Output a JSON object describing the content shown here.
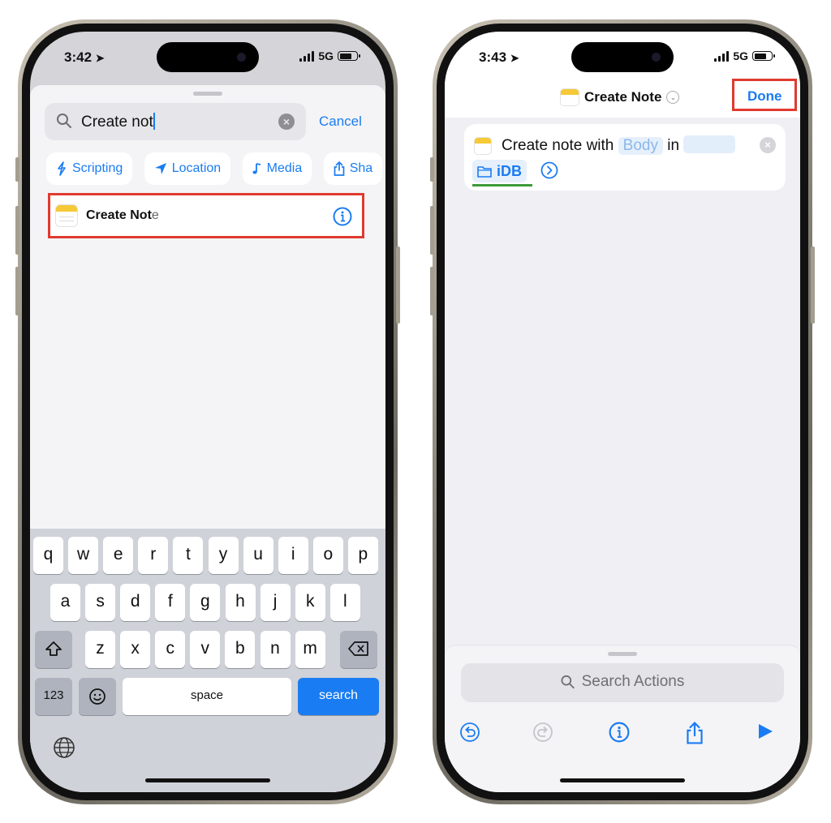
{
  "left_phone": {
    "status": {
      "time": "3:42",
      "network": "5G"
    },
    "search": {
      "value": "Create not",
      "cancel_label": "Cancel"
    },
    "categories": [
      {
        "label": "Scripting",
        "icon": "scripting-icon"
      },
      {
        "label": "Location",
        "icon": "location-arrow-icon"
      },
      {
        "label": "Media",
        "icon": "music-note-icon"
      },
      {
        "label": "Sha",
        "icon": "share-icon"
      }
    ],
    "result": {
      "label_bold": "Create Not",
      "label_soft": "e",
      "icon": "notes-app-icon",
      "highlight_color": "#e03a2f"
    },
    "keyboard": {
      "row1": [
        "q",
        "w",
        "e",
        "r",
        "t",
        "y",
        "u",
        "i",
        "o",
        "p"
      ],
      "row2": [
        "a",
        "s",
        "d",
        "f",
        "g",
        "h",
        "j",
        "k",
        "l"
      ],
      "row3": [
        "z",
        "x",
        "c",
        "v",
        "b",
        "n",
        "m"
      ],
      "numbers_label": "123",
      "space_label": "space",
      "action_label": "search"
    }
  },
  "right_phone": {
    "status": {
      "time": "3:43",
      "network": "5G"
    },
    "nav": {
      "title": "Create Note",
      "done_label": "Done",
      "highlight_color": "#e03a2f"
    },
    "action": {
      "prefix": "Create note with",
      "body_token": "Body",
      "connector": "in",
      "folder": "iDB"
    },
    "search_placeholder": "Search Actions",
    "accent": "#1a7cf2"
  }
}
